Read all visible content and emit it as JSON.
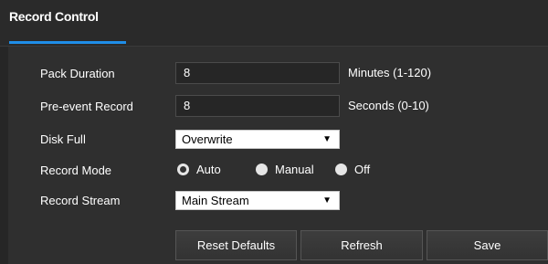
{
  "tab": {
    "label": "Record Control"
  },
  "pack_duration": {
    "label": "Pack Duration",
    "value": "8",
    "hint": "Minutes (1-120)"
  },
  "pre_event": {
    "label": "Pre-event Record",
    "value": "8",
    "hint": "Seconds (0-10)"
  },
  "disk_full": {
    "label": "Disk Full",
    "selected": "Overwrite"
  },
  "record_mode": {
    "label": "Record Mode",
    "options": [
      "Auto",
      "Manual",
      "Off"
    ],
    "selected": "Auto"
  },
  "record_stream": {
    "label": "Record Stream",
    "selected": "Main Stream"
  },
  "buttons": {
    "reset": "Reset Defaults",
    "refresh": "Refresh",
    "save": "Save"
  },
  "icons": {
    "dropdown": "chevron-down-icon",
    "radio": "radio-icon"
  },
  "colors": {
    "accent": "#1f8ee8",
    "background": "#2f2f2f"
  }
}
